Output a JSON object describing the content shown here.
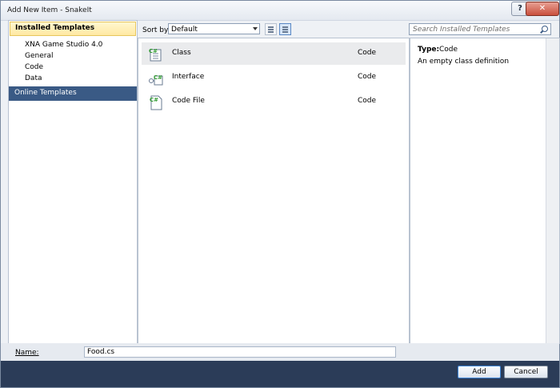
{
  "window": {
    "title": "Add New Item - SnakeIt",
    "help_label": "?",
    "close_label": "✕"
  },
  "left": {
    "header": "Installed Templates",
    "items": [
      {
        "label": "XNA Game Studio 4.0"
      },
      {
        "label": "General"
      },
      {
        "label": "Code"
      },
      {
        "label": "Data"
      }
    ],
    "online": "Online Templates"
  },
  "toolbar": {
    "sort_label": "Sort by:",
    "sort_value": "Default"
  },
  "search": {
    "placeholder": "Search Installed Templates"
  },
  "templates": [
    {
      "name": "Class",
      "language": "Code",
      "selected": true
    },
    {
      "name": "Interface",
      "language": "Code",
      "selected": false
    },
    {
      "name": "Code File",
      "language": "Code",
      "selected": false
    }
  ],
  "details": {
    "type_label": "Type:",
    "type_value": "Code",
    "description": "An empty class definition"
  },
  "name_field": {
    "label": "Name:",
    "value": "Food.cs"
  },
  "buttons": {
    "add": "Add",
    "cancel": "Cancel"
  },
  "colors": {
    "selected_row": "#eaebed",
    "online_highlight": "#3a5a85",
    "footer": "#2b3c58",
    "header_gold": "#ffe9a3"
  }
}
